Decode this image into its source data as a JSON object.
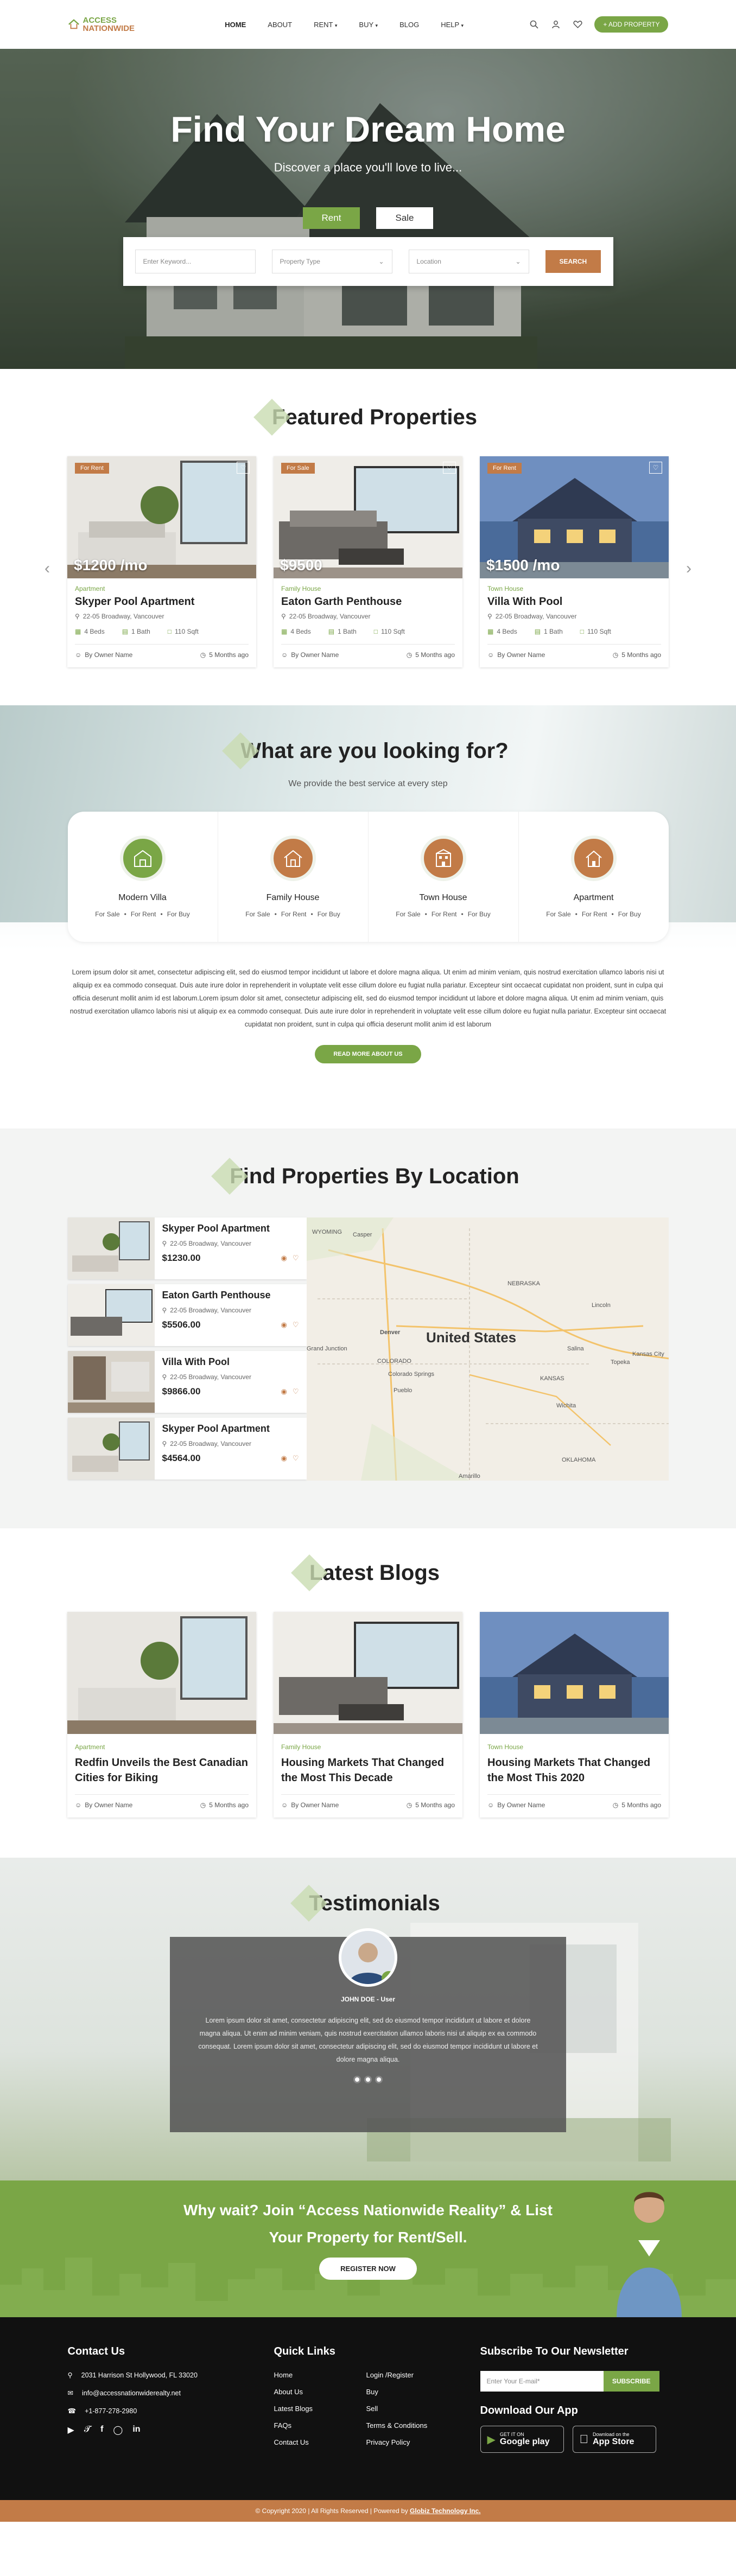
{
  "header": {
    "logo_line1": "ACCESS",
    "logo_line2": "NATIONWIDE",
    "nav": [
      "HOME",
      "ABOUT",
      "RENT",
      "BUY",
      "BLOG",
      "HELP"
    ],
    "add_property": "ADD PROPERTY"
  },
  "hero": {
    "title": "Find Your Dream Home",
    "subtitle": "Discover a place you'll love to live...",
    "tab_rent": "Rent",
    "tab_sale": "Sale",
    "keyword_placeholder": "Enter Keyword...",
    "property_type": "Property Type",
    "location": "Location",
    "search": "SEARCH"
  },
  "featured": {
    "title": "Featured Properties",
    "cards": [
      {
        "badge": "For Rent",
        "price": "$1200 /mo",
        "category": "Apartment",
        "title": "Skyper Pool Apartment",
        "address": "22-05 Broadway, Vancouver",
        "beds": "4 Beds",
        "baths": "1 Bath",
        "area": "110 Sqft",
        "owner": "By Owner Name",
        "time": "5 Months ago"
      },
      {
        "badge": "For Sale",
        "price": "$9500",
        "category": "Family House",
        "title": "Eaton Garth Penthouse",
        "address": "22-05 Broadway, Vancouver",
        "beds": "4 Beds",
        "baths": "1 Bath",
        "area": "110 Sqft",
        "owner": "By Owner Name",
        "time": "5 Months ago"
      },
      {
        "badge": "For Rent",
        "price": "$1500 /mo",
        "category": "Town House",
        "title": "Villa With Pool",
        "address": "22-05 Broadway, Vancouver",
        "beds": "4 Beds",
        "baths": "1 Bath",
        "area": "110 Sqft",
        "owner": "By Owner Name",
        "time": "5 Months ago"
      }
    ]
  },
  "looking": {
    "title": "What are you looking for?",
    "subtitle": "We provide the best service at every step",
    "categories": [
      {
        "name": "Modern Villa",
        "color": "#7aa646"
      },
      {
        "name": "Family House",
        "color": "#c27b47"
      },
      {
        "name": "Town House",
        "color": "#c27b47"
      },
      {
        "name": "Apartment",
        "color": "#c27b47"
      }
    ],
    "link_sale": "For Sale",
    "link_rent": "For Rent",
    "link_buy": "For Buy",
    "paragraph": "Lorem ipsum dolor sit amet, consectetur adipiscing elit, sed do eiusmod tempor incididunt ut labore et dolore magna aliqua. Ut enim ad minim veniam, quis nostrud exercitation ullamco laboris nisi ut aliquip ex ea commodo consequat. Duis aute irure dolor in reprehenderit in voluptate velit esse cillum dolore eu fugiat nulla pariatur. Excepteur sint occaecat cupidatat non proident, sunt in culpa qui officia deserunt mollit anim id est laborum.Lorem ipsum dolor sit amet, consectetur adipiscing elit, sed do eiusmod tempor incididunt ut labore et dolore magna aliqua. Ut enim ad minim veniam, quis nostrud exercitation ullamco laboris nisi ut aliquip ex ea commodo consequat. Duis aute irure dolor in reprehenderit in voluptate velit esse cillum dolore eu fugiat nulla pariatur. Excepteur sint occaecat cupidatat non proident, sunt in culpa qui officia deserunt mollit anim id est laborum",
    "read_more": "READ MORE ABOUT US"
  },
  "location": {
    "title": "Find Properties By Location",
    "items": [
      {
        "title": "Skyper Pool Apartment",
        "address": "22-05 Broadway, Vancouver",
        "price": "$1230.00"
      },
      {
        "title": "Eaton Garth Penthouse",
        "address": "22-05 Broadway, Vancouver",
        "price": "$5506.00"
      },
      {
        "title": "Villa With Pool",
        "address": "22-05 Broadway, Vancouver",
        "price": "$9866.00"
      },
      {
        "title": "Skyper Pool Apartment",
        "address": "22-05 Broadway, Vancouver",
        "price": "$4564.00"
      }
    ],
    "map": {
      "country": "United States",
      "labels": [
        "WYOMING",
        "Casper",
        "NEBRASKA",
        "Denver",
        "Grand Junction",
        "COLORADO",
        "Colorado Springs",
        "Pueblo",
        "KANSAS",
        "Wichita",
        "Kansas City",
        "OKLAHOMA",
        "Amarillo",
        "Lincoln",
        "Salina",
        "Topeka"
      ]
    }
  },
  "blogs": {
    "title": "Latest Blogs",
    "items": [
      {
        "category": "Apartment",
        "title": "Redfin Unveils the Best Canadian Cities for Biking",
        "owner": "By Owner Name",
        "time": "5 Months ago"
      },
      {
        "category": "Family House",
        "title": "Housing Markets That Changed the Most This Decade",
        "owner": "By Owner Name",
        "time": "5 Months ago"
      },
      {
        "category": "Town House",
        "title": "Housing Markets That Changed the Most This 2020",
        "owner": "By Owner Name",
        "time": "5 Months ago"
      }
    ]
  },
  "testimonials": {
    "title": "Testimonials",
    "name": "JOHN DOE - User",
    "text": "Lorem ipsum dolor sit amet, consectetur adipiscing elit, sed do eiusmod tempor incididunt ut labore et dolore magna aliqua. Ut enim ad minim veniam, quis nostrud exercitation ullamco laboris nisi ut aliquip ex ea commodo consequat. Lorem ipsum dolor sit amet, consectetur adipiscing elit, sed do eiusmod tempor incididunt ut labore et dolore magna aliqua."
  },
  "cta": {
    "line1": "Why wait? Join “Access Nationwide Reality” & List",
    "line2": "Your Property for Rent/Sell.",
    "button": "REGISTER NOW"
  },
  "footer": {
    "contact_title": "Contact Us",
    "address": "2031 Harrison St Hollywood, FL 33020",
    "email": "info@accessnationwiderealty.net",
    "phone": "+1-877-278-2980",
    "links_title": "Quick Links",
    "links": [
      "Home",
      "Login /Register",
      "About Us",
      "Buy",
      "Latest Blogs",
      "Sell",
      "FAQs",
      "Terms & Conditions",
      "Contact Us",
      "Privacy Policy"
    ],
    "newsletter_title": "Subscribe To Our Newsletter",
    "email_placeholder": "Enter Your E-mail*",
    "subscribe": "SUBSCRIBE",
    "app_title": "Download Our App",
    "gplay_small": "GET IT ON",
    "gplay": "Google play",
    "appstore_small": "Download on the",
    "appstore": "App Store",
    "copyright": "© Copyright 2020  |  All Rights Reserved  |  Powered by",
    "powered": "Globiz Technology Inc."
  },
  "colors": {
    "green": "#7aa646",
    "brown": "#c27b47"
  }
}
